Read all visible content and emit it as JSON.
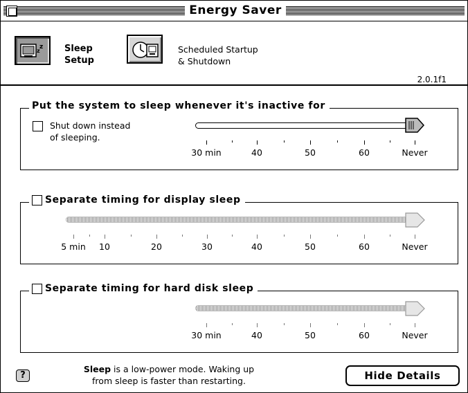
{
  "window": {
    "title": "Energy Saver"
  },
  "toolbar": {
    "sleep_setup": {
      "line1": "Sleep",
      "line2": "Setup",
      "icon": "sleep-monitor-icon"
    },
    "scheduled": {
      "line1": "Scheduled Startup",
      "line2": "& Shutdown",
      "icon": "clock-computer-icon"
    },
    "version": "2.0.1f1"
  },
  "system_sleep": {
    "title": "Put the system to sleep whenever it's inactive for",
    "shutdown_line1": "Shut down instead",
    "shutdown_line2": "of sleeping.",
    "shutdown_checked": false,
    "selected": "Never",
    "labels": [
      "30 min",
      "40",
      "50",
      "60",
      "Never"
    ]
  },
  "display_sleep": {
    "title": "Separate timing for display sleep",
    "checked": false,
    "selected": "Never",
    "labels": [
      "5 min",
      "10",
      "20",
      "30",
      "40",
      "50",
      "60",
      "Never"
    ]
  },
  "disk_sleep": {
    "title": "Separate timing for hard disk sleep",
    "checked": false,
    "selected": "Never",
    "labels": [
      "30 min",
      "40",
      "50",
      "60",
      "Never"
    ]
  },
  "help": {
    "icon": "question-mark-icon",
    "icon_glyph": "?",
    "bold": "Sleep",
    "text1": " is a low-power mode. Waking up",
    "text2": "from sleep is faster than restarting."
  },
  "hide_details": "Hide Details"
}
